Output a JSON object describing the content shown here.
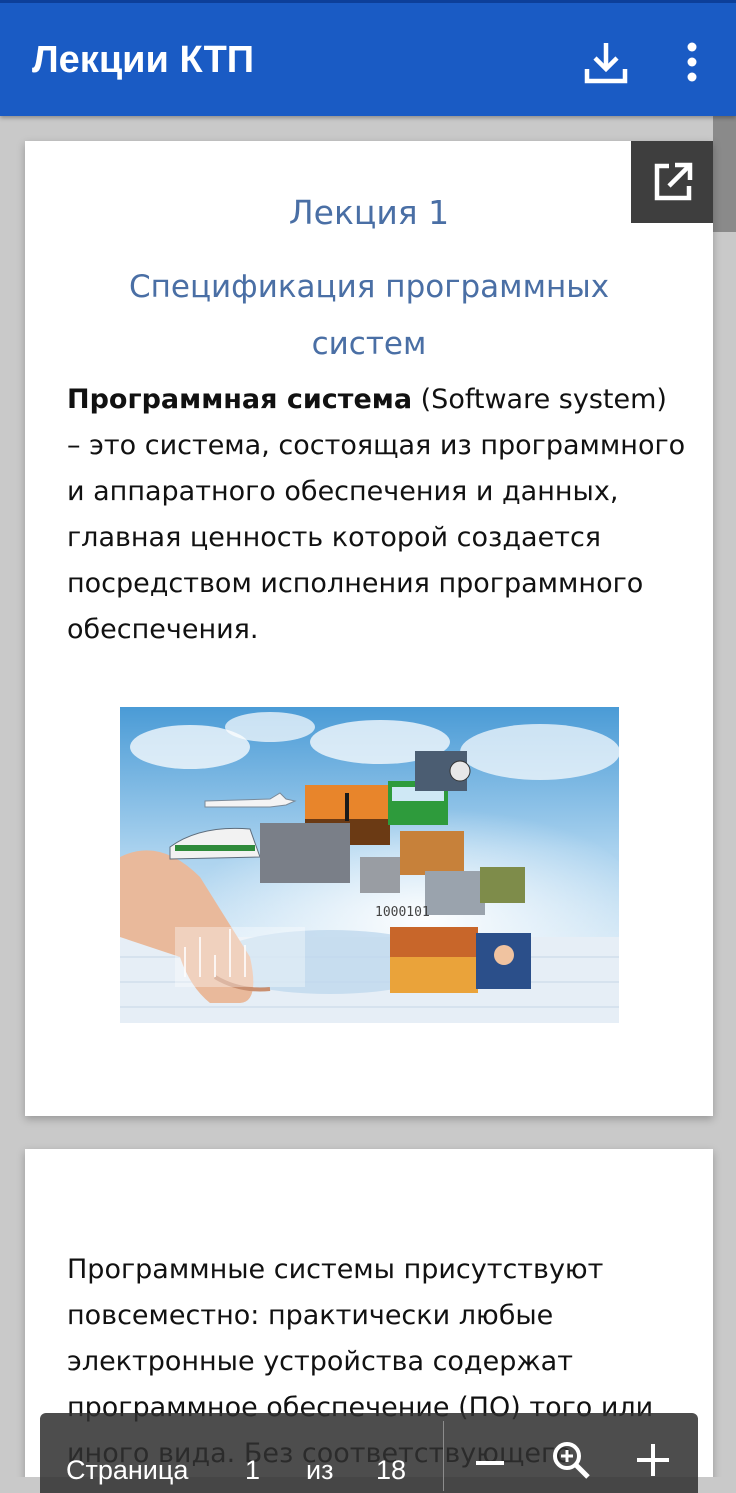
{
  "app": {
    "title": "Лекции КТП",
    "download_icon": "download-icon",
    "more_icon": "more-vert-icon",
    "accent": "#1a5bc4"
  },
  "document": {
    "open_external_icon": "open-in-new-icon",
    "page1": {
      "heading_number": "Лекция 1",
      "heading_title": "Спецификация программных систем",
      "term": "Программная система",
      "definition": " (Software system) – это система, состоящая из программного и аппаратного обеспечения и данных, главная ценность которой создается посредством исполнения программного обеспечения.",
      "illustration_caption": "1000101"
    },
    "page2": {
      "paragraph": "Программные системы присутствуют повсеместно: практически любые электронные устройства содержат программное обеспечение (ПО) того или иного вида. Без соответствующего"
    }
  },
  "pager": {
    "page_label": "Страница",
    "current_page": "1",
    "of_label": "из",
    "total_pages": "18",
    "zoom_out_icon": "minus-icon",
    "zoom_icon": "zoom-in-icon",
    "zoom_in_icon": "plus-icon"
  }
}
